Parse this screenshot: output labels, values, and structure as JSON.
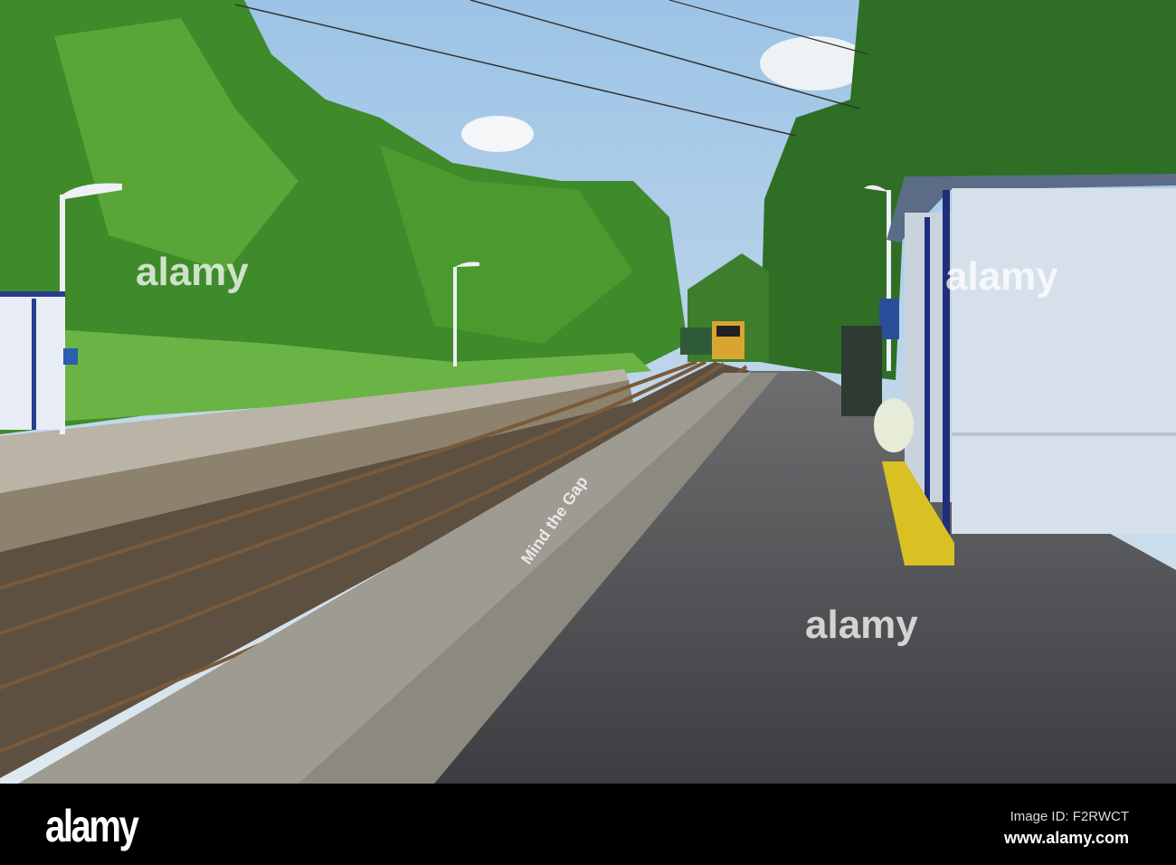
{
  "photo": {
    "watermarks": [
      "alamy",
      "alamy",
      "alamy"
    ],
    "platform_text": "Mind the Gap"
  },
  "footer": {
    "logo": "alamy",
    "image_id": "Image ID: F2RWCT",
    "url": "www.alamy.com"
  }
}
